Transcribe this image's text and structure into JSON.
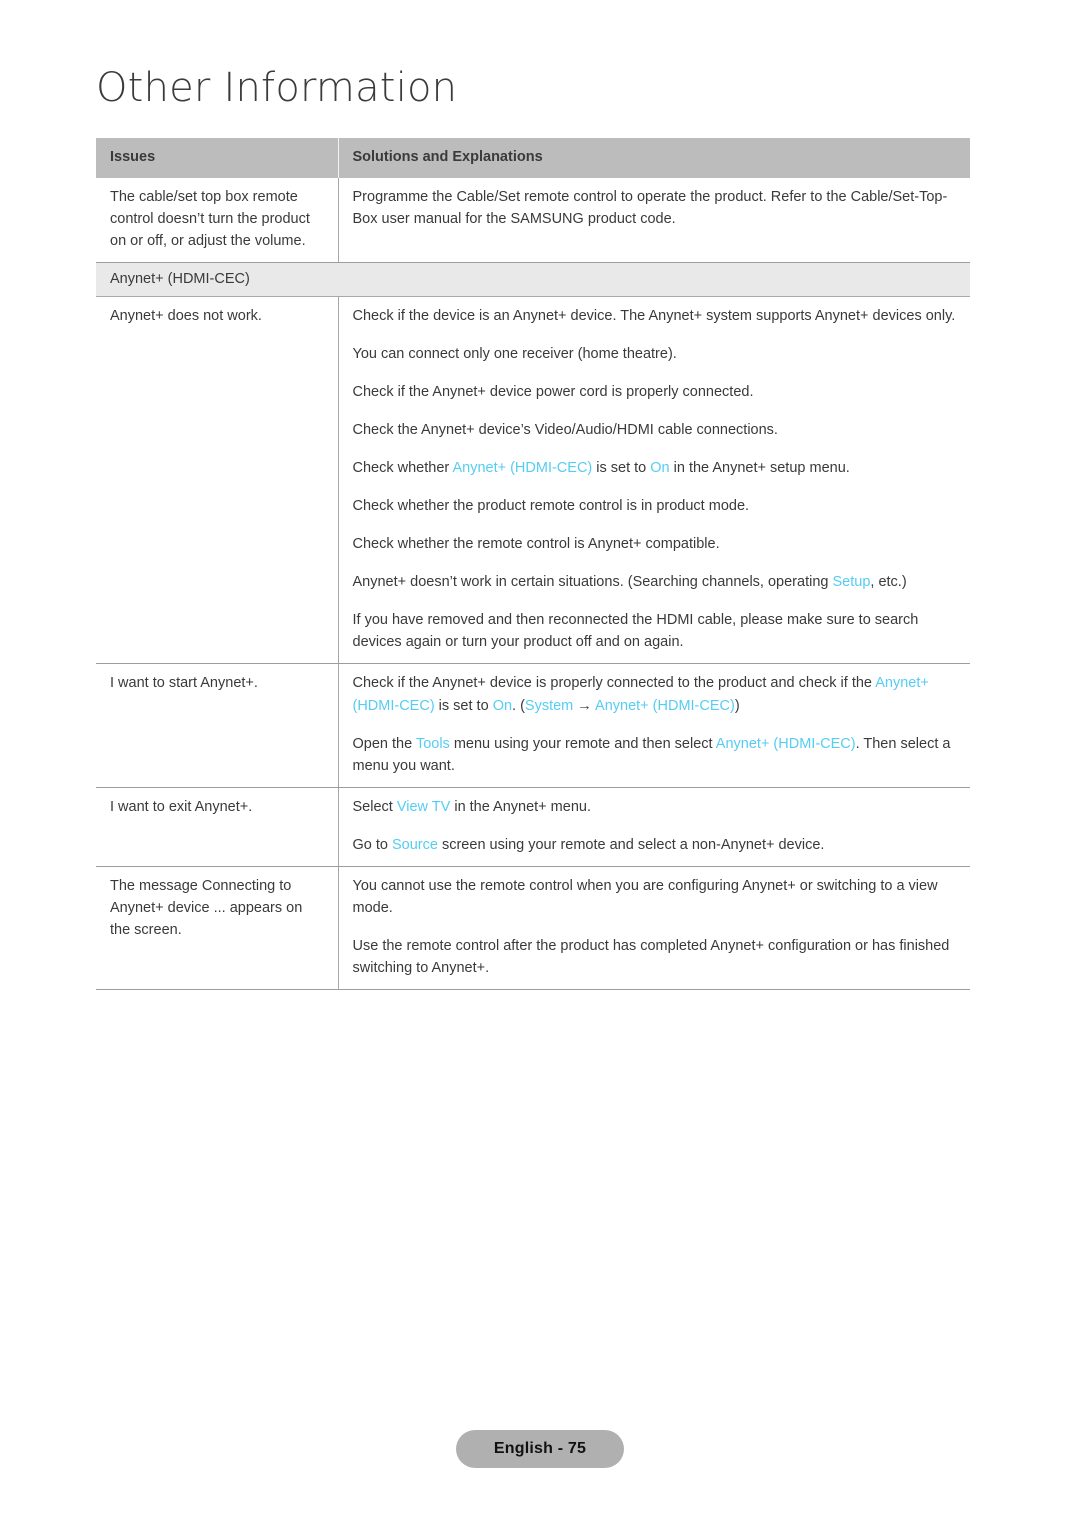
{
  "page": {
    "title": "Other Information",
    "footer_label": "English - 75",
    "link_color": "#55cdf2",
    "header_bg": "#bcbcbc",
    "section_bg": "#e9e9e9"
  },
  "table": {
    "headers": {
      "issues": "Issues",
      "solutions": "Solutions and Explanations"
    },
    "rows": [
      {
        "type": "data",
        "issue": "The cable/set top box remote control doesn’t turn the product on or off, or adjust the volume.",
        "solutions": [
          [
            {
              "t": "Programme the Cable/Set remote control to operate the product. Refer to the Cable/Set-Top-Box user manual for the SAMSUNG product code."
            }
          ]
        ]
      },
      {
        "type": "section",
        "label": "Anynet+ (HDMI-CEC)"
      },
      {
        "type": "data",
        "issue": "Anynet+ does not work.",
        "solutions": [
          [
            {
              "t": "Check if the device is an Anynet+ device. The Anynet+ system supports Anynet+ devices only."
            }
          ],
          [
            {
              "t": "You can connect only one receiver (home theatre)."
            }
          ],
          [
            {
              "t": "Check if the Anynet+ device power cord is properly connected."
            }
          ],
          [
            {
              "t": "Check the Anynet+ device’s Video/Audio/HDMI cable connections."
            }
          ],
          [
            {
              "t": "Check whether "
            },
            {
              "t": "Anynet+ (HDMI-CEC)",
              "link": true
            },
            {
              "t": " is set to "
            },
            {
              "t": "On",
              "link": true
            },
            {
              "t": " in the Anynet+ setup menu."
            }
          ],
          [
            {
              "t": "Check whether the product remote control is in product mode."
            }
          ],
          [
            {
              "t": "Check whether the remote control is Anynet+ compatible."
            }
          ],
          [
            {
              "t": "Anynet+ doesn’t work in certain situations. (Searching channels, operating "
            },
            {
              "t": "Setup",
              "link": true
            },
            {
              "t": ", etc.)"
            }
          ],
          [
            {
              "t": "If you have removed and then reconnected the HDMI cable, please make sure to search devices again or turn your product off and on again."
            }
          ]
        ]
      },
      {
        "type": "data",
        "issue": "I want to start Anynet+.",
        "solutions": [
          [
            {
              "t": "Check if the Anynet+ device is properly connected to the product and check if the "
            },
            {
              "t": "Anynet+ (HDMI-CEC)",
              "link": true
            },
            {
              "t": " is set to "
            },
            {
              "t": "On",
              "link": true
            },
            {
              "t": ". ("
            },
            {
              "t": "System",
              "link": true
            },
            {
              "t": " → ",
              "arrow": true
            },
            {
              "t": "Anynet+ (HDMI-CEC)",
              "link": true
            },
            {
              "t": ")"
            }
          ],
          [
            {
              "t": "Open the "
            },
            {
              "t": "Tools",
              "link": true
            },
            {
              "t": " menu using your remote and then select "
            },
            {
              "t": "Anynet+ (HDMI-CEC)",
              "link": true
            },
            {
              "t": ". Then select a menu you want."
            }
          ]
        ]
      },
      {
        "type": "data",
        "issue": "I want to exit Anynet+.",
        "solutions": [
          [
            {
              "t": "Select "
            },
            {
              "t": "View TV",
              "link": true
            },
            {
              "t": " in the Anynet+ menu."
            }
          ],
          [
            {
              "t": "Go to "
            },
            {
              "t": "Source",
              "link": true
            },
            {
              "t": " screen using your remote and select a non-Anynet+ device."
            }
          ]
        ]
      },
      {
        "type": "data",
        "issue": "The message Connecting to Anynet+ device ... appears on the screen.",
        "solutions": [
          [
            {
              "t": "You cannot use the remote control when you are configuring Anynet+ or switching to a view mode."
            }
          ],
          [
            {
              "t": "Use the remote control after the product has completed Anynet+ configuration or has finished switching to Anynet+."
            }
          ]
        ]
      }
    ]
  }
}
